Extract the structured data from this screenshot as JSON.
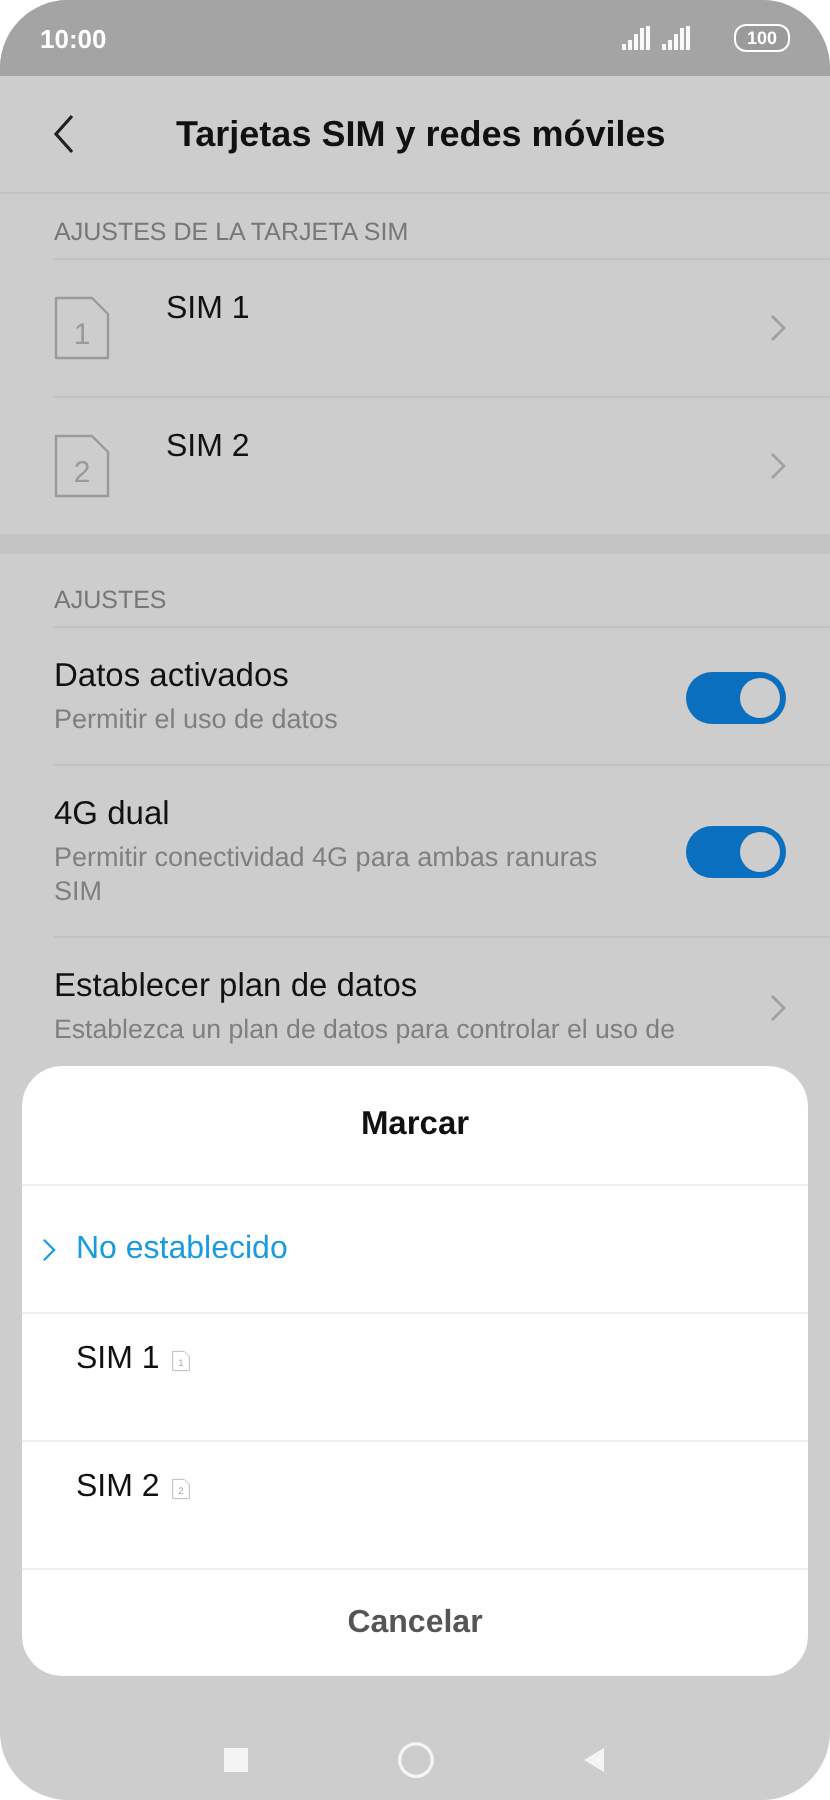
{
  "status_bar": {
    "time": "10:00",
    "battery": "100"
  },
  "header": {
    "title": "Tarjetas SIM y redes móviles"
  },
  "sections": [
    {
      "header": "AJUSTES DE LA TARJETA SIM",
      "items": [
        {
          "kind": "sim",
          "number": "1",
          "title": "SIM 1"
        },
        {
          "kind": "sim",
          "number": "2",
          "title": "SIM 2"
        }
      ]
    },
    {
      "header": "AJUSTES",
      "items": [
        {
          "kind": "toggle",
          "title": "Datos activados",
          "subtitle": "Permitir el uso de datos",
          "on": true
        },
        {
          "kind": "toggle",
          "title": "4G dual",
          "subtitle": "Permitir conectividad 4G para ambas ranuras SIM",
          "on": true
        },
        {
          "kind": "link",
          "title": "Establecer plan de datos",
          "subtitle": "Establezca un plan de datos para controlar el uso de"
        }
      ]
    }
  ],
  "dialog": {
    "title": "Marcar",
    "options": [
      {
        "label": "No establecido",
        "selected": true
      },
      {
        "label": "SIM 1",
        "sim": "1",
        "selected": false
      },
      {
        "label": "SIM 2",
        "sim": "2",
        "selected": false
      }
    ],
    "cancel": "Cancelar"
  }
}
